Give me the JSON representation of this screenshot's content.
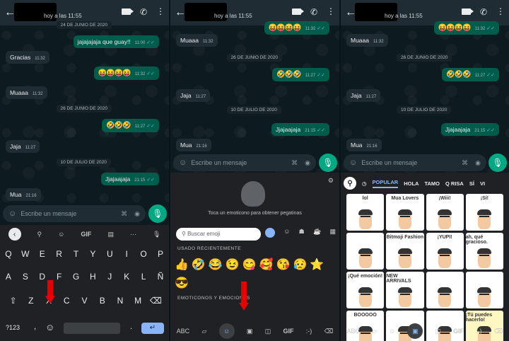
{
  "header": {
    "status": "hoy a las 11:55"
  },
  "panel1": {
    "messages": [
      {
        "dir": "date",
        "text": "24 DE JUNIO DE 2020"
      },
      {
        "dir": "out",
        "text": "jajajajaja que guay!!",
        "time": "11:00"
      },
      {
        "dir": "in",
        "text": "Gracias",
        "time": "11:32"
      },
      {
        "dir": "out",
        "text": "😝😝😝😝",
        "time": "11:32"
      },
      {
        "dir": "in",
        "text": "Muaaa",
        "time": "11:32"
      },
      {
        "dir": "date",
        "text": "26 DE JUNIO DE 2020"
      },
      {
        "dir": "out",
        "text": "🤣🤣🤣",
        "time": "11:27"
      },
      {
        "dir": "in",
        "text": "Jaja",
        "time": "11:27"
      },
      {
        "dir": "date",
        "text": "10 DE JULIO DE 2020"
      },
      {
        "dir": "out",
        "text": "Jjajaajaja",
        "time": "21:15"
      },
      {
        "dir": "in",
        "text": "Mua",
        "time": "21:16"
      }
    ],
    "input_placeholder": "Escribe un mensaje",
    "keyboard": {
      "tools": [
        "GIF"
      ],
      "row1": [
        "Q",
        "W",
        "E",
        "R",
        "T",
        "Y",
        "U",
        "I",
        "O",
        "P"
      ],
      "row2": [
        "A",
        "S",
        "D",
        "F",
        "G",
        "H",
        "J",
        "K",
        "L",
        "Ñ"
      ],
      "row3": [
        "Z",
        "X",
        "C",
        "V",
        "B",
        "N",
        "M"
      ],
      "symbols_key": "?123",
      "comma": ",",
      "period": "."
    }
  },
  "panel2": {
    "messages": [
      {
        "dir": "out",
        "text": "😝😝😝😝",
        "time": "11:32"
      },
      {
        "dir": "in",
        "text": "Muaaa",
        "time": "11:32"
      },
      {
        "dir": "date",
        "text": "26 DE JUNIO DE 2020"
      },
      {
        "dir": "out",
        "text": "🤣🤣🤣",
        "time": "11:27"
      },
      {
        "dir": "in",
        "text": "Jaja",
        "time": "11:27"
      },
      {
        "dir": "date",
        "text": "10 DE JULIO DE 2020"
      },
      {
        "dir": "out",
        "text": "Jjajaajaja",
        "time": "21:15"
      },
      {
        "dir": "in",
        "text": "Mua",
        "time": "21:16"
      }
    ],
    "input_placeholder": "Escribe un mensaje",
    "emoji": {
      "hint": "Toca un emoticono para obtener pegatinas",
      "search_placeholder": "Buscar emoji",
      "recent_label": "USADO RECIENTEMENTE",
      "recent": "👍🤣😂😉😋🥰😘😥⭐😎",
      "section_label": "EMOTICONOS Y EMOCIONES",
      "bottom": [
        "ABC",
        "GIF",
        ":-)"
      ]
    }
  },
  "panel3": {
    "messages": [
      {
        "dir": "out",
        "text": "😝😝😝😝",
        "time": "11:32"
      },
      {
        "dir": "in",
        "text": "Muaaa",
        "time": "11:32"
      },
      {
        "dir": "date",
        "text": "26 DE JUNIO DE 2020"
      },
      {
        "dir": "out",
        "text": "🤣🤣🤣",
        "time": "11:27"
      },
      {
        "dir": "in",
        "text": "Jaja",
        "time": "11:27"
      },
      {
        "dir": "date",
        "text": "10 DE JULIO DE 2020"
      },
      {
        "dir": "out",
        "text": "Jjajaajaja",
        "time": "21:15"
      },
      {
        "dir": "in",
        "text": "Mua",
        "time": "21:16"
      }
    ],
    "input_placeholder": "Escribe un mensaje",
    "stickers": {
      "tabs": [
        "POPULAR",
        "HOLA",
        "TAMO",
        "Q RISA",
        "SÍ",
        "VI"
      ],
      "items": [
        "lol",
        "Mua Lovers",
        "¡Wiii!",
        "¡Sí!",
        "",
        "Bitmoji Fashion",
        "¡YUPI!",
        "ah, qué gracioso.",
        "¡Qué emoción!",
        "NEW ARRIVALS",
        "",
        "",
        "BOOOOO",
        "",
        "",
        "¡Tú puedes hacerlo!"
      ],
      "bottom": [
        "ABC",
        "GIF",
        ":-)"
      ]
    }
  },
  "colors": {
    "accent": "#00a884",
    "outgoing": "#005c4b",
    "incoming": "#202c33",
    "arrow": "#e60000"
  }
}
